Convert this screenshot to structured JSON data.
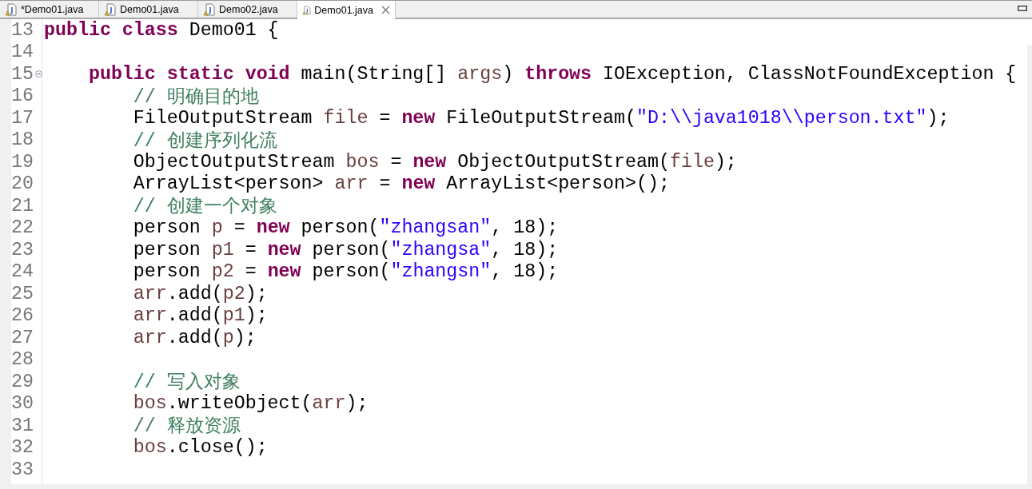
{
  "tabs": [
    {
      "label": "*Demo01.java",
      "selected": false,
      "closable": false
    },
    {
      "label": "Demo01.java",
      "selected": false,
      "closable": false
    },
    {
      "label": "Demo02.java",
      "selected": false,
      "closable": false
    },
    {
      "label": "Demo01.java",
      "selected": true,
      "closable": true
    }
  ],
  "editor": {
    "lines": [
      {
        "number": "13",
        "fold_marker": false,
        "tokens": [
          {
            "kind": "keyword",
            "text": "public class"
          },
          {
            "kind": "plain",
            "text": " Demo01 {"
          }
        ]
      },
      {
        "number": "14",
        "fold_marker": false
      },
      {
        "number": "15",
        "fold_marker": true,
        "tokens": [
          {
            "kind": "keyword",
            "text": "    public static void"
          },
          {
            "kind": "plain",
            "text": " main(String[] "
          },
          {
            "kind": "variable",
            "text": "args"
          },
          {
            "kind": "plain",
            "text": ") "
          },
          {
            "kind": "keyword",
            "text": "throws"
          },
          {
            "kind": "plain",
            "text": " IOException, ClassNotFoundException {"
          }
        ]
      },
      {
        "number": "16",
        "fold_marker": false,
        "tokens": [
          {
            "kind": "comment",
            "text": "        // 明确目的地"
          }
        ]
      },
      {
        "number": "17",
        "fold_marker": false,
        "tokens": [
          {
            "kind": "plain",
            "text": "        FileOutputStream "
          },
          {
            "kind": "variable",
            "text": "file"
          },
          {
            "kind": "plain",
            "text": " = "
          },
          {
            "kind": "keyword",
            "text": "new"
          },
          {
            "kind": "plain",
            "text": " FileOutputStream("
          },
          {
            "kind": "string",
            "text": "\"D:\\\\java1018\\\\person.txt\""
          },
          {
            "kind": "plain",
            "text": ");"
          }
        ]
      },
      {
        "number": "18",
        "fold_marker": false,
        "tokens": [
          {
            "kind": "comment",
            "text": "        // 创建序列化流"
          }
        ]
      },
      {
        "number": "19",
        "fold_marker": false,
        "tokens": [
          {
            "kind": "plain",
            "text": "        ObjectOutputStream "
          },
          {
            "kind": "variable",
            "text": "bos"
          },
          {
            "kind": "plain",
            "text": " = "
          },
          {
            "kind": "keyword",
            "text": "new"
          },
          {
            "kind": "plain",
            "text": " ObjectOutputStream("
          },
          {
            "kind": "variable",
            "text": "file"
          },
          {
            "kind": "plain",
            "text": ");"
          }
        ]
      },
      {
        "number": "20",
        "fold_marker": false,
        "tokens": [
          {
            "kind": "plain",
            "text": "        ArrayList<person> "
          },
          {
            "kind": "variable",
            "text": "arr"
          },
          {
            "kind": "plain",
            "text": " = "
          },
          {
            "kind": "keyword",
            "text": "new"
          },
          {
            "kind": "plain",
            "text": " ArrayList<person>();"
          }
        ]
      },
      {
        "number": "21",
        "fold_marker": false,
        "tokens": [
          {
            "kind": "comment",
            "text": "        // 创建一个对象"
          }
        ]
      },
      {
        "number": "22",
        "fold_marker": false,
        "tokens": [
          {
            "kind": "plain",
            "text": "        person "
          },
          {
            "kind": "variable",
            "text": "p"
          },
          {
            "kind": "plain",
            "text": " = "
          },
          {
            "kind": "keyword",
            "text": "new"
          },
          {
            "kind": "plain",
            "text": " person("
          },
          {
            "kind": "string",
            "text": "\"zhangsan\""
          },
          {
            "kind": "plain",
            "text": ", 18);"
          }
        ]
      },
      {
        "number": "23",
        "fold_marker": false,
        "tokens": [
          {
            "kind": "plain",
            "text": "        person "
          },
          {
            "kind": "variable",
            "text": "p1"
          },
          {
            "kind": "plain",
            "text": " = "
          },
          {
            "kind": "keyword",
            "text": "new"
          },
          {
            "kind": "plain",
            "text": " person("
          },
          {
            "kind": "string",
            "text": "\"zhangsa\""
          },
          {
            "kind": "plain",
            "text": ", 18);"
          }
        ]
      },
      {
        "number": "24",
        "fold_marker": false,
        "tokens": [
          {
            "kind": "plain",
            "text": "        person "
          },
          {
            "kind": "variable",
            "text": "p2"
          },
          {
            "kind": "plain",
            "text": " = "
          },
          {
            "kind": "keyword",
            "text": "new"
          },
          {
            "kind": "plain",
            "text": " person("
          },
          {
            "kind": "string",
            "text": "\"zhangsn\""
          },
          {
            "kind": "plain",
            "text": ", 18);"
          }
        ]
      },
      {
        "number": "25",
        "fold_marker": false,
        "tokens": [
          {
            "kind": "variable",
            "text": "        arr"
          },
          {
            "kind": "plain",
            "text": ".add("
          },
          {
            "kind": "variable",
            "text": "p2"
          },
          {
            "kind": "plain",
            "text": ");"
          }
        ]
      },
      {
        "number": "26",
        "fold_marker": false,
        "tokens": [
          {
            "kind": "variable",
            "text": "        arr"
          },
          {
            "kind": "plain",
            "text": ".add("
          },
          {
            "kind": "variable",
            "text": "p1"
          },
          {
            "kind": "plain",
            "text": ");"
          }
        ]
      },
      {
        "number": "27",
        "fold_marker": false,
        "tokens": [
          {
            "kind": "variable",
            "text": "        arr"
          },
          {
            "kind": "plain",
            "text": ".add("
          },
          {
            "kind": "variable",
            "text": "p"
          },
          {
            "kind": "plain",
            "text": ");"
          }
        ]
      },
      {
        "number": "28",
        "fold_marker": false
      },
      {
        "number": "29",
        "fold_marker": false,
        "tokens": [
          {
            "kind": "comment",
            "text": "        // 写入对象"
          }
        ]
      },
      {
        "number": "30",
        "fold_marker": false,
        "tokens": [
          {
            "kind": "variable",
            "text": "        bos"
          },
          {
            "kind": "plain",
            "text": ".writeObject("
          },
          {
            "kind": "variable",
            "text": "arr"
          },
          {
            "kind": "plain",
            "text": ");"
          }
        ]
      },
      {
        "number": "31",
        "fold_marker": false,
        "tokens": [
          {
            "kind": "comment",
            "text": "        // 释放资源"
          }
        ]
      },
      {
        "number": "32",
        "fold_marker": false,
        "tokens": [
          {
            "kind": "variable",
            "text": "        bos"
          },
          {
            "kind": "plain",
            "text": ".close();"
          }
        ]
      },
      {
        "number": "33",
        "fold_marker": false
      }
    ]
  }
}
